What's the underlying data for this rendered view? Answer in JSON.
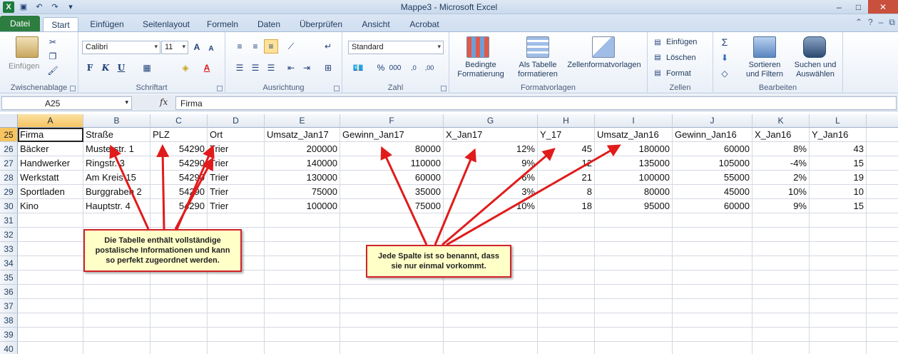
{
  "window": {
    "title": "Mappe3  -  Microsoft Excel",
    "buttons": [
      "minimize",
      "maximize",
      "close"
    ]
  },
  "tabs": [
    {
      "label": "Datei"
    },
    {
      "label": "Start"
    },
    {
      "label": "Einfügen"
    },
    {
      "label": "Seitenlayout"
    },
    {
      "label": "Formeln"
    },
    {
      "label": "Daten"
    },
    {
      "label": "Überprüfen"
    },
    {
      "label": "Ansicht"
    },
    {
      "label": "Acrobat"
    }
  ],
  "ribbon": {
    "clipboard": {
      "label": "Zwischenablage",
      "paste": "Einfügen"
    },
    "font": {
      "label": "Schriftart",
      "name": "Calibri",
      "size": "11"
    },
    "alignment": {
      "label": "Ausrichtung"
    },
    "number": {
      "label": "Zahl",
      "format": "Standard"
    },
    "styles": {
      "label": "Formatvorlagen",
      "conditional": "Bedingte\nFormatierung",
      "as_table": "Als Tabelle\nformatieren",
      "cell_styles": "Zellenformatvorlagen"
    },
    "cells": {
      "label": "Zellen",
      "insert": "Einfügen",
      "delete": "Löschen",
      "format": "Format"
    },
    "editing": {
      "label": "Bearbeiten",
      "sort": "Sortieren\nund Filtern",
      "find": "Suchen und\nAuswählen"
    }
  },
  "formula_bar": {
    "name_box": "A25",
    "fx": "fx",
    "content": "Firma"
  },
  "grid": {
    "columns": [
      "A",
      "B",
      "C",
      "D",
      "E",
      "F",
      "G",
      "H",
      "I",
      "J",
      "K",
      "L",
      "M"
    ],
    "active_column": "A",
    "active_row": "25",
    "rows": [
      {
        "num": "25",
        "cells": [
          "Firma",
          "Straße",
          "PLZ",
          "Ort",
          "Umsatz_Jan17",
          "Gewinn_Jan17",
          "X_Jan17",
          "Y_17",
          "Umsatz_Jan16",
          "Gewinn_Jan16",
          "X_Jan16",
          "Y_Jan16",
          ""
        ]
      },
      {
        "num": "26",
        "cells": [
          "Bäcker",
          "Musterstr. 1",
          "54290",
          "Trier",
          "200000",
          "80000",
          "12%",
          "45",
          "180000",
          "60000",
          "8%",
          "43",
          ""
        ]
      },
      {
        "num": "27",
        "cells": [
          "Handwerker",
          "Ringstr. 3",
          "54290",
          "Trier",
          "140000",
          "110000",
          "9%",
          "12",
          "135000",
          "105000",
          "-4%",
          "15",
          ""
        ]
      },
      {
        "num": "28",
        "cells": [
          "Werkstatt",
          "Am Kreis 15",
          "54290",
          "Trier",
          "130000",
          "60000",
          "-6%",
          "21",
          "100000",
          "55000",
          "2%",
          "19",
          ""
        ]
      },
      {
        "num": "29",
        "cells": [
          "Sportladen",
          "Burggraben 2",
          "54290",
          "Trier",
          "75000",
          "35000",
          "3%",
          "8",
          "80000",
          "45000",
          "10%",
          "10",
          ""
        ]
      },
      {
        "num": "30",
        "cells": [
          "Kino",
          "Hauptstr. 4",
          "54290",
          "Trier",
          "100000",
          "75000",
          "10%",
          "18",
          "95000",
          "60000",
          "9%",
          "15",
          ""
        ]
      },
      {
        "num": "31",
        "cells": []
      },
      {
        "num": "32",
        "cells": []
      },
      {
        "num": "33",
        "cells": []
      },
      {
        "num": "34",
        "cells": []
      },
      {
        "num": "35",
        "cells": []
      },
      {
        "num": "36",
        "cells": []
      },
      {
        "num": "37",
        "cells": []
      },
      {
        "num": "38",
        "cells": []
      },
      {
        "num": "39",
        "cells": []
      },
      {
        "num": "40",
        "cells": []
      }
    ]
  },
  "callouts": {
    "left": "Die Tabelle enthält vollständige postalische Informationen und kann so perfekt zugeordnet werden.",
    "right": "Jede Spalte ist so benannt, dass sie nur einmal vorkommt."
  },
  "colors": {
    "arrow": "#e11b1b",
    "callout_border": "#d1232a",
    "callout_fill": "#ffffc8",
    "file_tab": "#2c7d3f"
  }
}
